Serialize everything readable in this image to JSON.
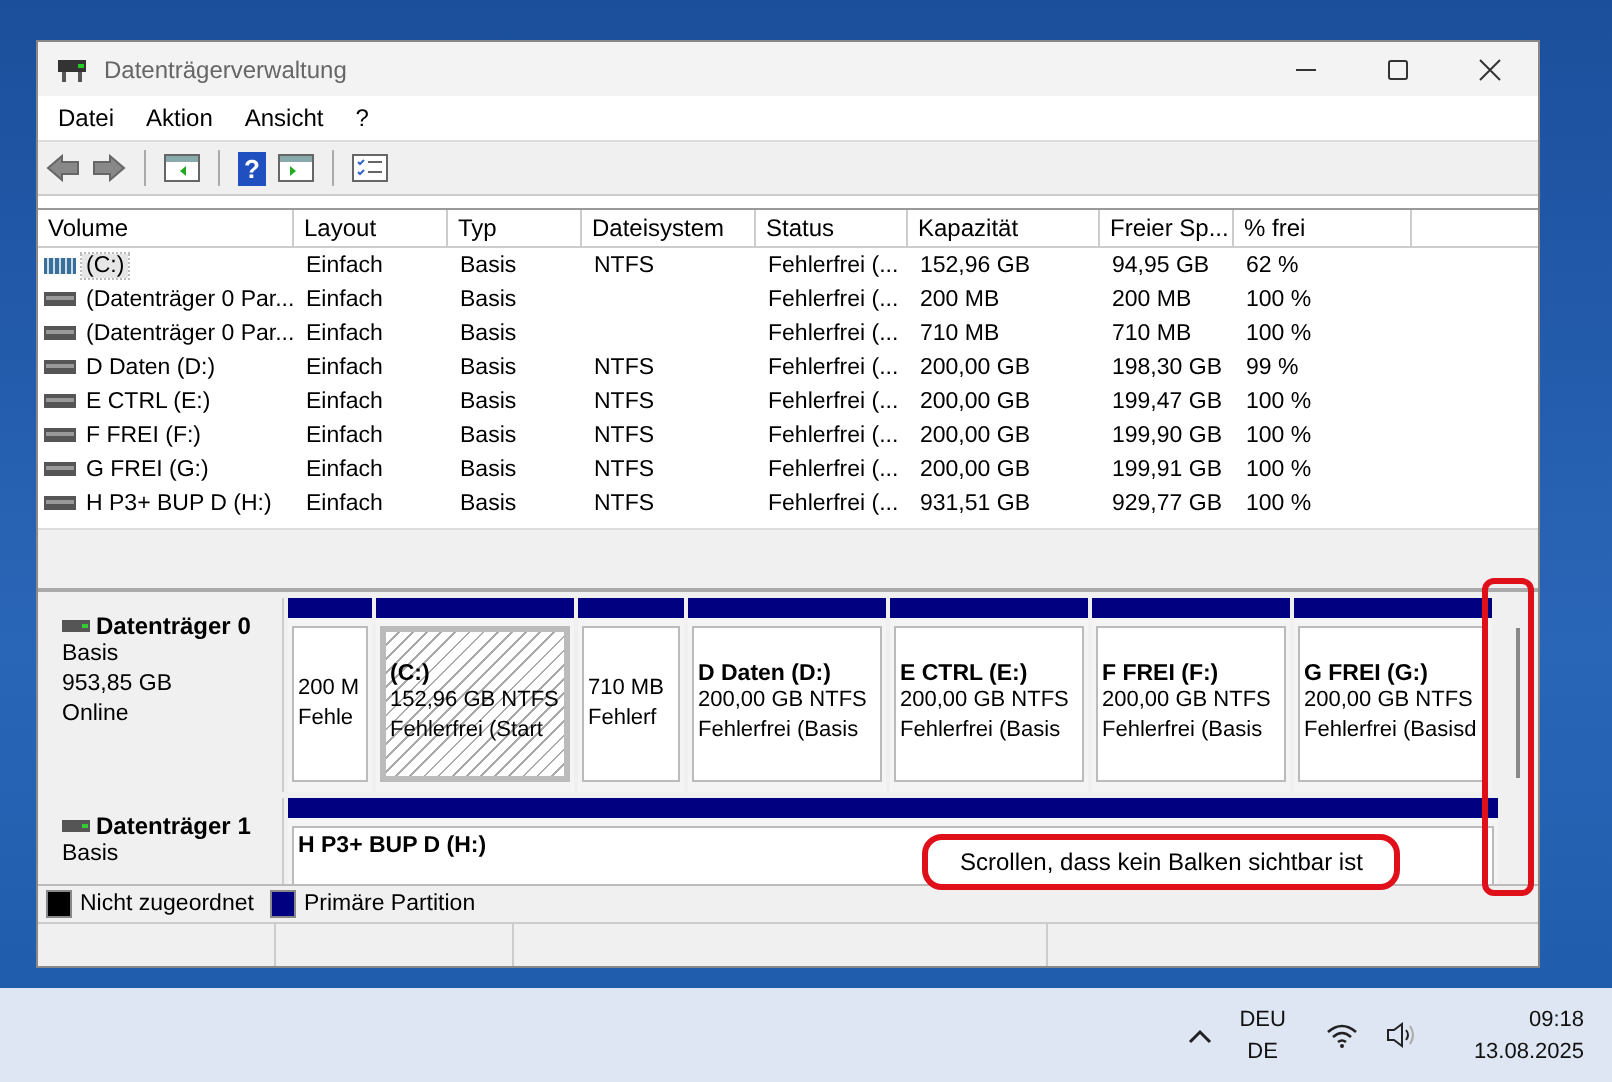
{
  "window": {
    "title": "Datenträgerverwaltung"
  },
  "menu": [
    "Datei",
    "Aktion",
    "Ansicht",
    "?"
  ],
  "toolbar": {
    "help_glyph": "?"
  },
  "table": {
    "columns": [
      "Volume",
      "Layout",
      "Typ",
      "Dateisystem",
      "Status",
      "Kapazität",
      "Freier Sp...",
      "% frei"
    ],
    "rows": [
      {
        "kind": "system",
        "selected": true,
        "cells": [
          "(C:)",
          "Einfach",
          "Basis",
          "NTFS",
          "Fehlerfrei (...",
          "152,96 GB",
          "94,95 GB",
          "62 %"
        ]
      },
      {
        "kind": "drive",
        "selected": false,
        "cells": [
          "(Datenträger 0 Par...",
          "Einfach",
          "Basis",
          "",
          "Fehlerfrei (...",
          "200 MB",
          "200 MB",
          "100 %"
        ]
      },
      {
        "kind": "drive",
        "selected": false,
        "cells": [
          "(Datenträger 0 Par...",
          "Einfach",
          "Basis",
          "",
          "Fehlerfrei (...",
          "710 MB",
          "710 MB",
          "100 %"
        ]
      },
      {
        "kind": "drive",
        "selected": false,
        "cells": [
          "D Daten (D:)",
          "Einfach",
          "Basis",
          "NTFS",
          "Fehlerfrei (...",
          "200,00 GB",
          "198,30 GB",
          "99 %"
        ]
      },
      {
        "kind": "drive",
        "selected": false,
        "cells": [
          "E CTRL (E:)",
          "Einfach",
          "Basis",
          "NTFS",
          "Fehlerfrei (...",
          "200,00 GB",
          "199,47 GB",
          "100 %"
        ]
      },
      {
        "kind": "drive",
        "selected": false,
        "cells": [
          "F FREI (F:)",
          "Einfach",
          "Basis",
          "NTFS",
          "Fehlerfrei (...",
          "200,00 GB",
          "199,90 GB",
          "100 %"
        ]
      },
      {
        "kind": "drive",
        "selected": false,
        "cells": [
          "G FREI (G:)",
          "Einfach",
          "Basis",
          "NTFS",
          "Fehlerfrei (...",
          "200,00 GB",
          "199,91 GB",
          "100 %"
        ]
      },
      {
        "kind": "drive",
        "selected": false,
        "cells": [
          "H P3+ BUP D (H:)",
          "Einfach",
          "Basis",
          "NTFS",
          "Fehlerfrei (...",
          "931,51 GB",
          "929,77 GB",
          "100 %"
        ]
      }
    ]
  },
  "disks": [
    {
      "name": "Datenträger 0",
      "info": [
        "Basis",
        "953,85 GB",
        "Online"
      ],
      "partitions": [
        {
          "selected": false,
          "lines": [
            "200 M",
            "Fehle"
          ]
        },
        {
          "selected": true,
          "name": "(C:)",
          "lines": [
            "152,96 GB NTFS",
            "Fehlerfrei (Start"
          ]
        },
        {
          "selected": false,
          "lines": [
            "710 MB",
            "Fehlerf"
          ]
        },
        {
          "selected": false,
          "name": "D Daten  (D:)",
          "lines": [
            "200,00 GB NTFS",
            "Fehlerfrei (Basis"
          ]
        },
        {
          "selected": false,
          "name": "E CTRL  (E:)",
          "lines": [
            "200,00 GB NTFS",
            "Fehlerfrei (Basis"
          ]
        },
        {
          "selected": false,
          "name": "F FREI  (F:)",
          "lines": [
            "200,00 GB NTFS",
            "Fehlerfrei (Basis"
          ]
        },
        {
          "selected": false,
          "name": "G FREI  (G:)",
          "lines": [
            "200,00 GB NTFS",
            "Fehlerfrei (Basisd"
          ]
        }
      ]
    },
    {
      "name": "Datenträger 1",
      "info": [
        "Basis"
      ],
      "partitions": [
        {
          "selected": false,
          "name": "H P3+ BUP D  (H:)"
        }
      ]
    }
  ],
  "legend": [
    {
      "label": "Nicht zugeordnet",
      "color": "#000000"
    },
    {
      "label": "Primäre Partition",
      "color": "#000080"
    }
  ],
  "annotation": "Scrollen, dass kein Balken sichtbar ist",
  "taskbar": {
    "language": "DEU",
    "layout": "DE",
    "time": "09:18",
    "date": "13.08.2025"
  }
}
